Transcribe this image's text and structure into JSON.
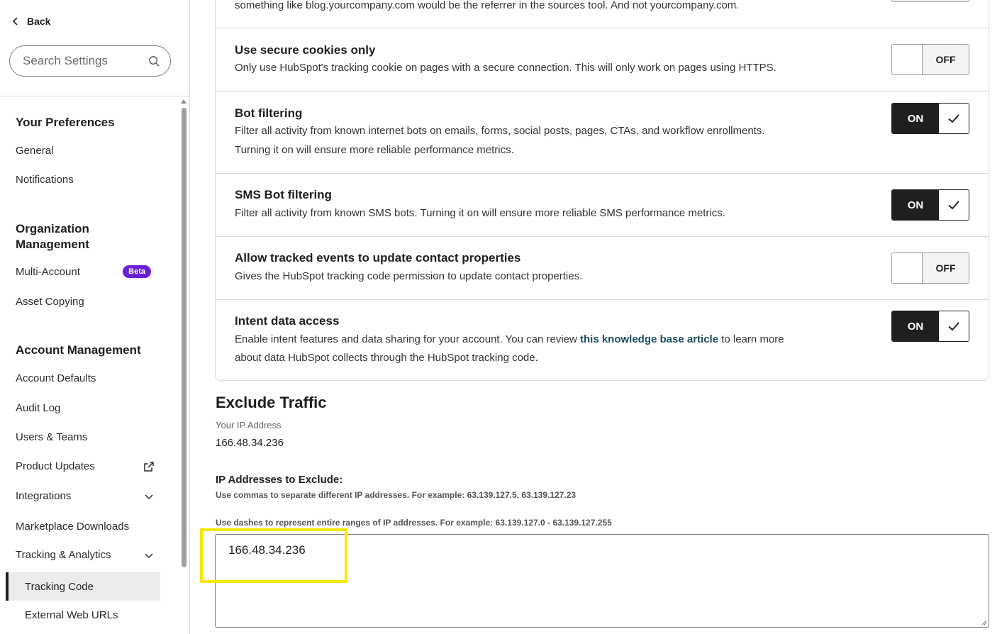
{
  "sidebar": {
    "back_label": "Back",
    "search_placeholder": "Search Settings",
    "sections": {
      "preferences": {
        "title": "Your Preferences",
        "items": [
          "General",
          "Notifications"
        ]
      },
      "organization": {
        "title": "Organization Management",
        "multi_account": "Multi-Account",
        "beta_badge": "Beta",
        "asset_copying": "Asset Copying"
      },
      "account": {
        "title": "Account Management",
        "account_defaults": "Account Defaults",
        "audit_log": "Audit Log",
        "users_teams": "Users & Teams",
        "product_updates": "Product Updates",
        "integrations": "Integrations",
        "marketplace_downloads": "Marketplace Downloads",
        "tracking_analytics": "Tracking & Analytics",
        "tracking_code": "Tracking Code",
        "external_web_urls": "External Web URLs"
      }
    }
  },
  "settings": {
    "top_desc": "something like blog.yourcompany.com would be the referrer in the sources tool. And not yourcompany.com.",
    "secure_cookies": {
      "title": "Use secure cookies only",
      "desc": "Only use HubSpot's tracking cookie on pages with a secure connection. This will only work on pages using HTTPS.",
      "state": "OFF"
    },
    "bot_filtering": {
      "title": "Bot filtering",
      "desc_line1": "Filter all activity from known internet bots on emails, forms, social posts, pages, CTAs, and workflow enrollments.",
      "desc_line2": "Turning it on will ensure more reliable performance metrics.",
      "state": "ON"
    },
    "sms_bot_filtering": {
      "title": "SMS Bot filtering",
      "desc": "Filter all activity from known SMS bots. Turning it on will ensure more reliable SMS performance metrics.",
      "state": "ON"
    },
    "tracked_events": {
      "title": "Allow tracked events to update contact properties",
      "desc": "Gives the HubSpot tracking code permission to update contact properties.",
      "state": "OFF"
    },
    "intent_data": {
      "title": "Intent data access",
      "desc_before": "Enable intent features and data sharing for your account. You can review ",
      "link": "this knowledge base article",
      "desc_after": " to learn more",
      "desc_line2": "about data HubSpot collects through the HubSpot tracking code.",
      "state": "ON"
    }
  },
  "exclude_traffic": {
    "title": "Exclude Traffic",
    "your_ip_label": "Your IP Address",
    "your_ip_value": "166.48.34.236",
    "exclude_label": "IP Addresses to Exclude:",
    "help_commas": "Use commas to separate different IP addresses. For example: 63.139.127.5, 63.139.127.23",
    "help_dashes": "Use dashes to represent entire ranges of IP addresses. For example: 63.139.127.0 - 63.139.127.255",
    "textarea_value": "166.48.34.236"
  },
  "colors": {
    "highlight": "#f5e800",
    "beta_badge": "#6a1fd8",
    "toggle_on": "#1f1f1f",
    "link": "#1a4d5c"
  }
}
